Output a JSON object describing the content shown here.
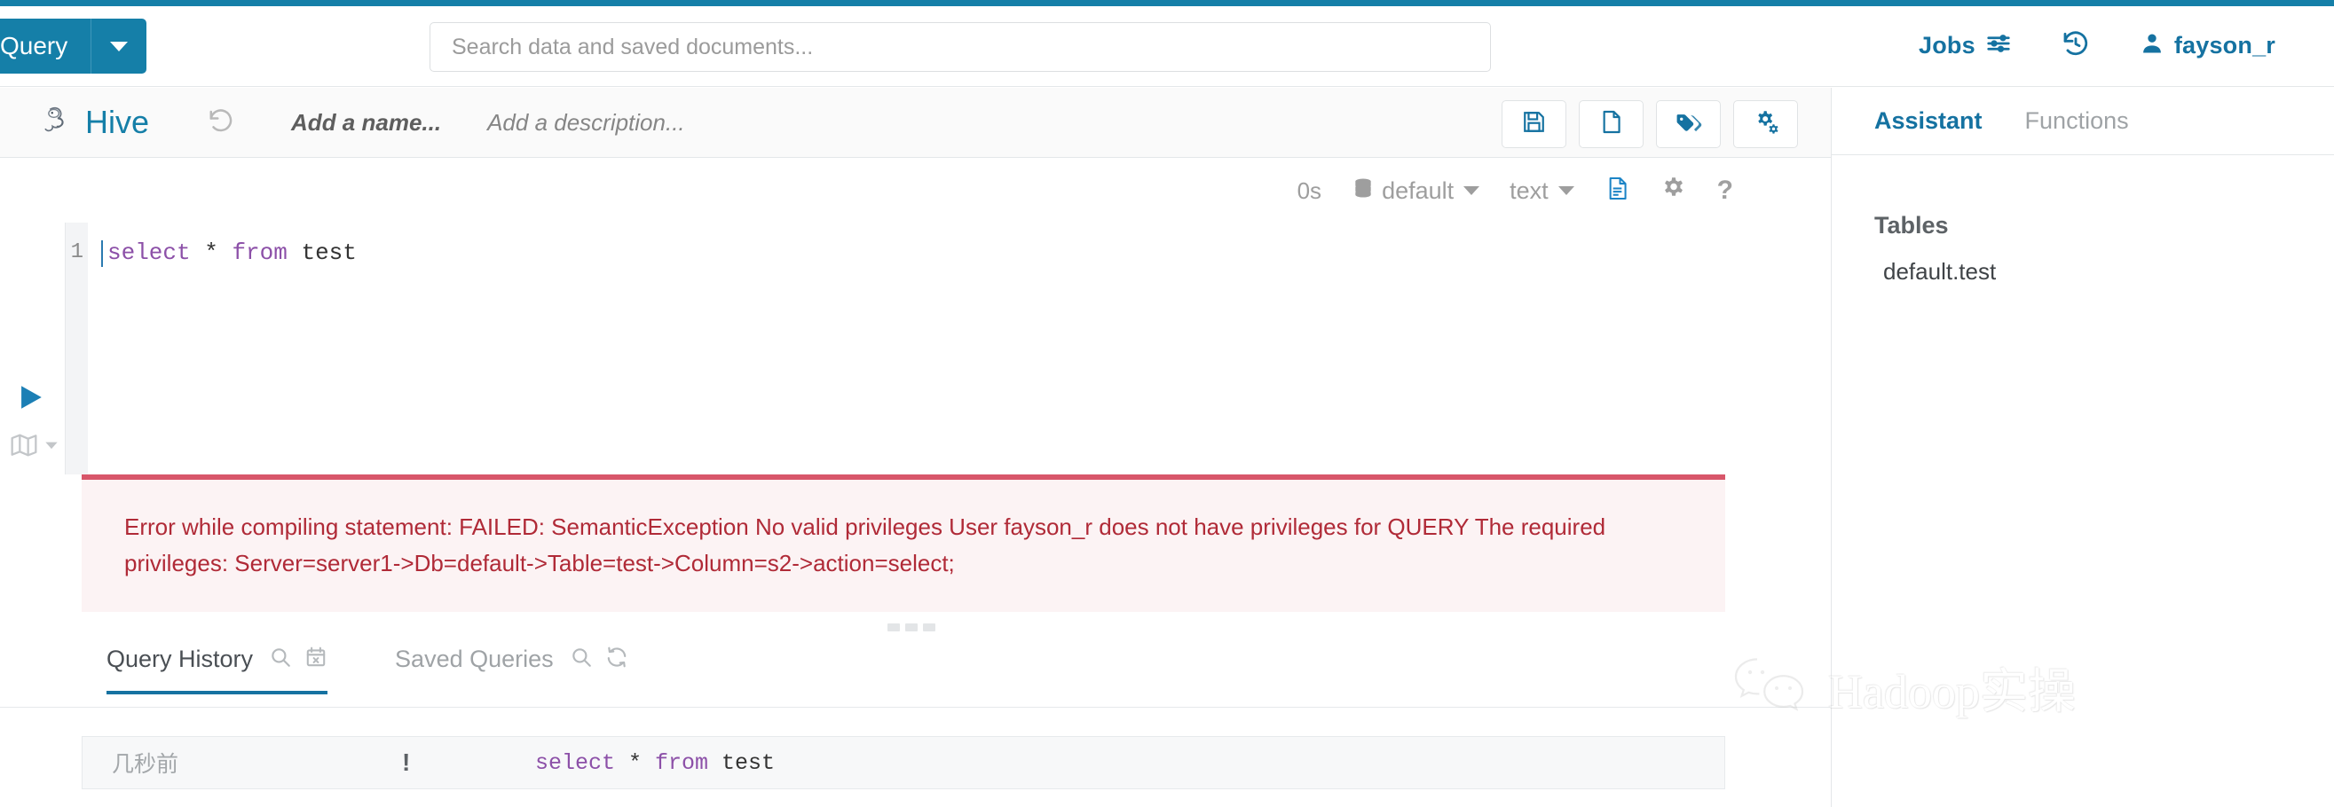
{
  "navbar": {
    "app_button": {
      "label": "Query",
      "icon": "chevron-down-icon"
    },
    "search": {
      "placeholder": "Search data and saved documents...",
      "value": ""
    },
    "jobs": {
      "label": "Jobs",
      "icon": "sliders-icon"
    },
    "history": {
      "icon": "history-icon"
    },
    "user": {
      "label": "fayson_r",
      "icon": "user-icon"
    }
  },
  "editor_header": {
    "engine": "Hive",
    "logo_icon": "hive-logo-icon",
    "undo_icon": "undo-icon",
    "name_placeholder": "Add a name...",
    "description_placeholder": "Add a description...",
    "actions": [
      {
        "name": "save",
        "icon": "floppy-save-icon"
      },
      {
        "name": "new-document",
        "icon": "new-document-icon"
      },
      {
        "name": "tags",
        "icon": "tags-icon"
      },
      {
        "name": "settings",
        "icon": "gears-icon"
      }
    ]
  },
  "editor_toolbar": {
    "elapsed": "0s",
    "database": "default",
    "database_icon": "database-icon",
    "format": "text",
    "result_icon": "document-lines-icon",
    "settings_icon": "gear-icon",
    "help_icon": "question-mark-icon"
  },
  "gutter": {
    "run_icon": "play-icon",
    "map_icon": "map-icon",
    "map_caret_icon": "chevron-down-icon"
  },
  "code": {
    "line_number": "1",
    "tokens": [
      {
        "text": "select",
        "type": "keyword"
      },
      {
        "text": " * ",
        "type": "plain"
      },
      {
        "text": "from",
        "type": "keyword"
      },
      {
        "text": " test",
        "type": "plain"
      }
    ],
    "full_text": "select * from test"
  },
  "error": {
    "message": "Error while compiling statement: FAILED: SemanticException No valid privileges User fayson_r does not have privileges for QUERY The required privileges: Server=server1->Db=default->Table=test->Column=s2->action=select;",
    "border_color": "#d8566a",
    "background_color": "#fcf3f4",
    "text_color": "#b02a37"
  },
  "result_tabs": [
    {
      "label": "Query History",
      "active": true,
      "icons": [
        "search-icon",
        "calendar-clear-icon"
      ]
    },
    {
      "label": "Saved Queries",
      "active": false,
      "icons": [
        "search-icon",
        "refresh-icon"
      ]
    }
  ],
  "history_rows": [
    {
      "time": "几秒前",
      "status": "!",
      "query": "select * from test"
    }
  ],
  "sidebar": {
    "tabs": [
      {
        "label": "Assistant",
        "active": true
      },
      {
        "label": "Functions",
        "active": false
      }
    ],
    "tables_title": "Tables",
    "tables": [
      {
        "name": "default.test"
      }
    ]
  },
  "watermark": {
    "text": "Hadoop实操",
    "icon": "wechat-icon"
  },
  "colors": {
    "accent": "#157fa8",
    "link": "#1572a1",
    "error": "#b02a37",
    "keyword": "#8c50a8"
  }
}
